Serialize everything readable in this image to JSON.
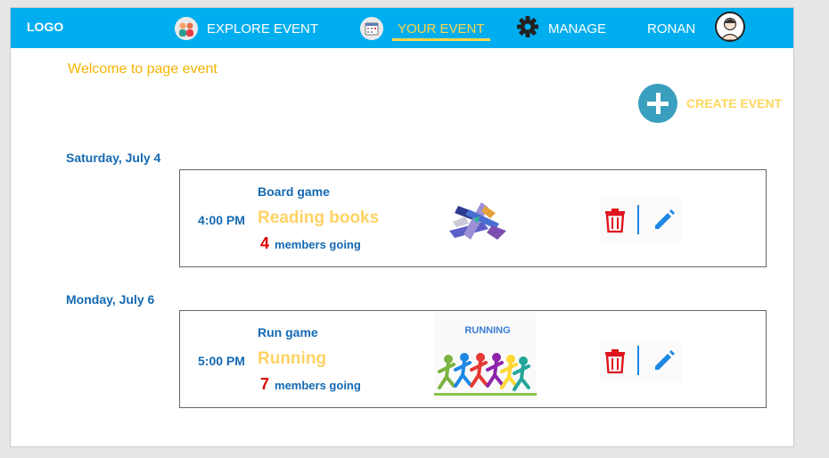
{
  "nav": {
    "logo": "LOGO",
    "items": [
      {
        "label": "EXPLORE EVENT",
        "icon": "people-icon"
      },
      {
        "label": "YOUR EVENT",
        "icon": "calendar-icon",
        "active": true
      },
      {
        "label": "MANAGE",
        "icon": "gear-icon"
      }
    ],
    "user": "RONAN"
  },
  "welcome": "Welcome to page event",
  "create_event": "CREATE EVENT",
  "days": [
    {
      "date": "Saturday, July 4",
      "events": [
        {
          "time": "4:00 PM",
          "category": "Board game",
          "title": "Reading books",
          "members_count": "4",
          "members_text": "members going",
          "image": "books-image"
        }
      ]
    },
    {
      "date": "Monday, July 6",
      "events": [
        {
          "time": "5:00 PM",
          "category": "Run game",
          "title": "Running",
          "members_count": "7",
          "members_text": "members going",
          "image": "running-image",
          "image_caption": "RUNNING"
        }
      ]
    }
  ],
  "colors": {
    "navbar": "#00aeef",
    "accent_yellow": "#ffd263",
    "text_blue": "#1469b3",
    "count_red": "#e00000",
    "create_teal": "#3a9fbf"
  }
}
